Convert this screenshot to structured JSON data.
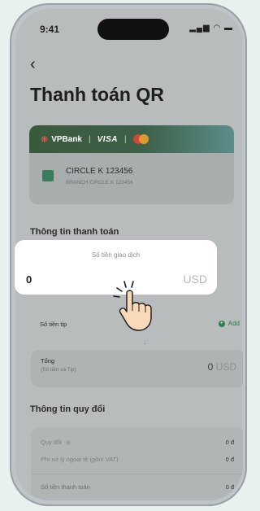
{
  "status": {
    "time": "9:41"
  },
  "header": {
    "back": "‹",
    "title": "Thanh toán QR"
  },
  "card": {
    "bank": "VPBank",
    "network": "VISA",
    "store_name": "CIRCLE K 123456",
    "store_branch": "BRANCH CIRCLE K 123456"
  },
  "payment_section": {
    "title": "Thông tin thanh toán",
    "amount_label": "Số tiền giao dịch",
    "amount_value": "0",
    "amount_currency": "USD",
    "tip_label": "Số tiền tip",
    "tip_add": "Add",
    "total_label": "Tổng",
    "total_sub": "(Số tiền và Tip)",
    "total_value": "0",
    "total_currency": "USD"
  },
  "conversion_section": {
    "title": "Thông tin quy đổi",
    "rows": [
      {
        "label": "Quy đổi",
        "value": "0 đ"
      },
      {
        "label": "Phí xử lý ngoại tệ (gồm VAT)",
        "value": "0 đ"
      },
      {
        "label": "Số tiền thanh toán",
        "value": "0 đ"
      }
    ]
  },
  "colors": {
    "accent_green": "#2e7d4f",
    "overlay": "#b9bcbd",
    "amount_card": "#ffffff"
  },
  "icons": [
    "back-icon",
    "store-icon",
    "plus-icon",
    "info-icon",
    "tap-hand-icon"
  ]
}
